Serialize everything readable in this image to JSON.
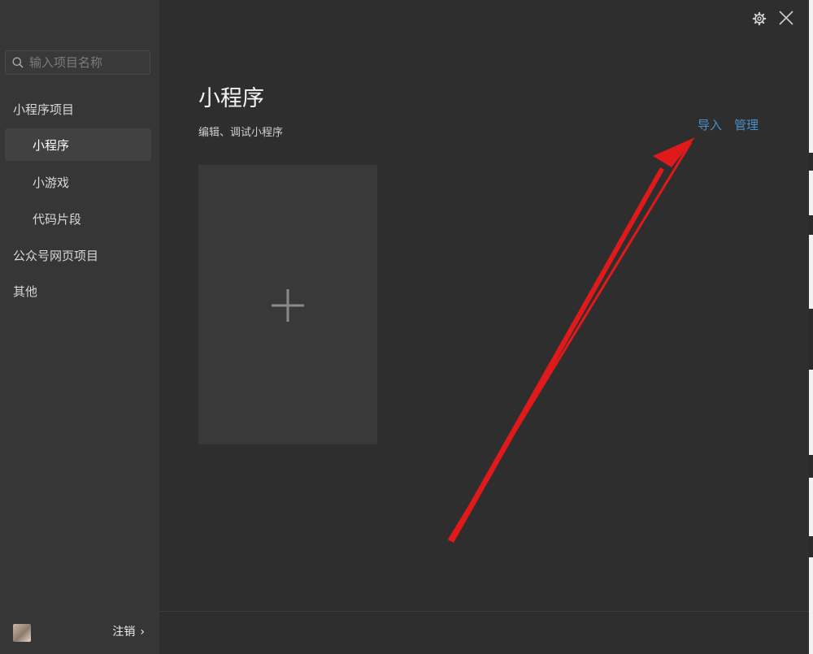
{
  "search": {
    "placeholder": "输入项目名称"
  },
  "sidebar": {
    "groups": [
      {
        "label": "小程序项目"
      },
      {
        "label": "公众号网页项目"
      },
      {
        "label": "其他"
      }
    ],
    "items": [
      {
        "label": "小程序",
        "active": true
      },
      {
        "label": "小游戏",
        "active": false
      },
      {
        "label": "代码片段",
        "active": false
      }
    ],
    "footer": {
      "logout_label": "注销",
      "chevron": "›"
    }
  },
  "main": {
    "title": "小程序",
    "subtitle": "编辑、调试小程序",
    "actions": {
      "import_label": "导入",
      "manage_label": "管理"
    }
  },
  "icons": {
    "search": "search-icon",
    "settings": "gear-icon",
    "close": "close-icon",
    "add": "plus-icon"
  },
  "colors": {
    "window_bg": "#2e2e2e",
    "sidebar_bg": "#363636",
    "link": "#4a8fc7",
    "annotation_arrow": "#e01a1a"
  }
}
